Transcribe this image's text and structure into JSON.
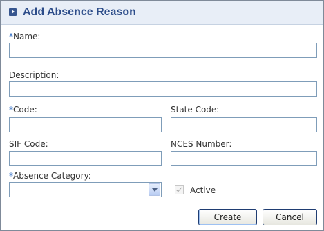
{
  "dialog": {
    "title": "Add Absence Reason",
    "title_icon": "arrow-right-box-icon"
  },
  "fields": {
    "name": {
      "required_mark": "*",
      "label": "Name:",
      "value": ""
    },
    "description": {
      "label": "Description:",
      "value": ""
    },
    "code": {
      "required_mark": "*",
      "label": "Code:",
      "value": ""
    },
    "state_code": {
      "label": "State Code:",
      "value": ""
    },
    "sif_code": {
      "label": "SIF Code:",
      "value": ""
    },
    "nces_number": {
      "label": "NCES Number:",
      "value": ""
    },
    "absence_category": {
      "required_mark": "*",
      "label": "Absence Category:",
      "selected": ""
    },
    "active": {
      "label": "Active",
      "checked": true,
      "disabled": true
    }
  },
  "buttons": {
    "create": "Create",
    "cancel": "Cancel"
  },
  "colors": {
    "title_text": "#2d4d8a",
    "title_bar_bg": "#e8eef7",
    "required_mark": "#2d6bc4",
    "field_border": "#7f9db9"
  }
}
